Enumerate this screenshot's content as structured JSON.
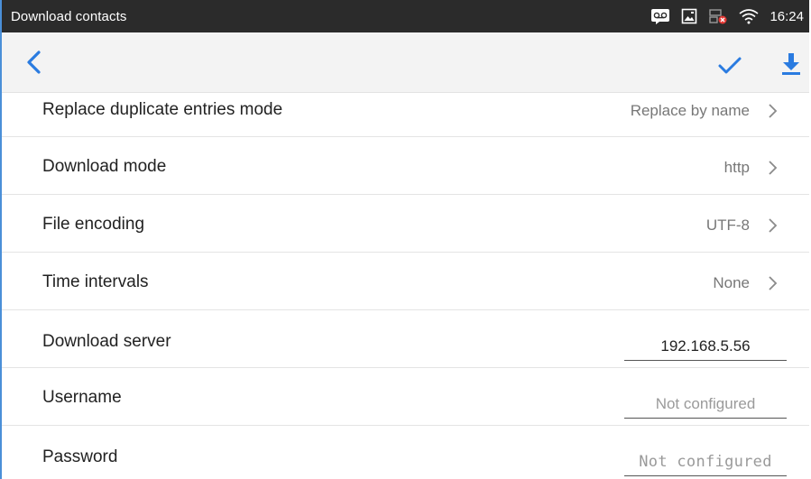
{
  "status_bar": {
    "title": "Download contacts",
    "time": "16:24"
  },
  "toolbar": {
    "back_icon": "chevron-left-icon",
    "confirm_icon": "check-icon",
    "download_icon": "download-icon",
    "accent_color": "#2a7be0"
  },
  "settings": {
    "replace_mode": {
      "label": "Replace duplicate entries mode",
      "value": "Replace by name"
    },
    "download_mode": {
      "label": "Download mode",
      "value": "http"
    },
    "file_encoding": {
      "label": "File encoding",
      "value": "UTF-8"
    },
    "time_intervals": {
      "label": "Time intervals",
      "value": "None"
    },
    "download_server": {
      "label": "Download server",
      "value": "192.168.5.56"
    },
    "username": {
      "label": "Username",
      "placeholder": "Not configured"
    },
    "password": {
      "label": "Password",
      "placeholder": "Not configured"
    }
  }
}
